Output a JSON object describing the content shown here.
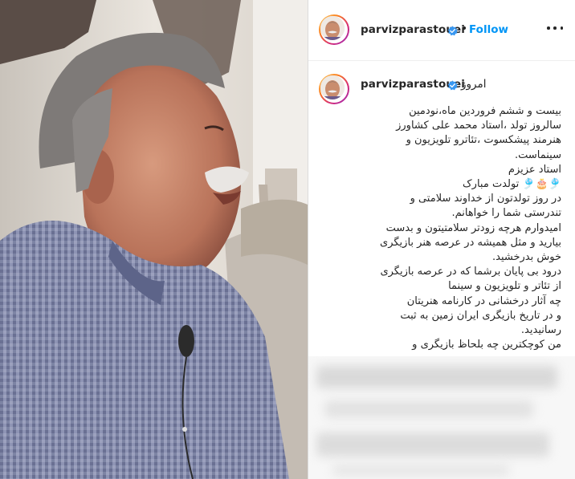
{
  "post": {
    "username": "parvizparastouei",
    "follow_label": "Follow",
    "separator": "•",
    "time_label": "امروز",
    "caption_lines": [
      "بیست و ششم فروردین ماه،نودمین",
      "سالروز تولد ،استاد محمد علی کشاورز",
      "هنرمند پیشکسوت ،تئاترو تلویزیون و",
      "سینماست.",
      "استاد عزیزم",
      "🎐🎂🎐 تولدت مبارک",
      "در روز تولدتون از خداوند سلامتی و",
      "تندرستی شما را خواهانم.",
      "امیدوارم هرچه زودتر سلامتیتون و بدست",
      "بیارید و مثل همیشه در عرصه هنر بازیگری",
      "خوش بدرخشید.",
      "درود بی پایان برشما که در عرصه بازیگری",
      "از تئاتر و تلویزیون و سینما",
      "چه آثار درخشانی در کارنامه هنریتان",
      "و در تاریخ بازیگری ایران زمین به ثبت",
      "رسانیدید.",
      "من کوچکترین چه بلحاظ بازیگری و"
    ]
  },
  "icons": {
    "verified": "verified-badge-icon",
    "more": "more-options-icon"
  },
  "colors": {
    "link_blue": "#0095f6",
    "verified_blue": "#3897f0",
    "text": "#262626"
  }
}
